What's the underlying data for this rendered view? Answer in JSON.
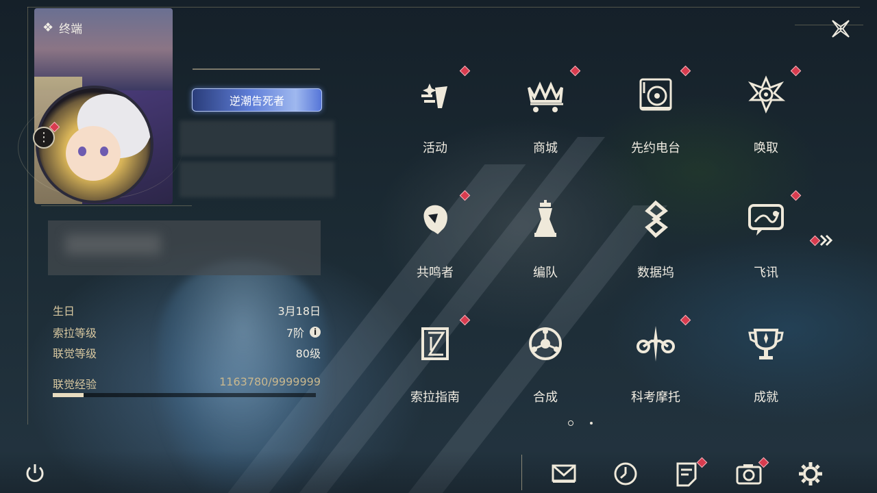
{
  "header": {
    "terminal_label": "终端"
  },
  "profile": {
    "title_badge": "逆潮告死者",
    "stats": [
      {
        "label": "生日",
        "value": "3月18日"
      },
      {
        "label": "索拉等级",
        "value": "7阶"
      },
      {
        "label": "联觉等级",
        "value": "80级"
      }
    ],
    "exp": {
      "label": "联觉经验",
      "value": "1163780/9999999",
      "progress_fraction": 0.116
    }
  },
  "menu": {
    "items": [
      {
        "label": "活动",
        "icon": "event-icon",
        "badge": true
      },
      {
        "label": "商城",
        "icon": "shop-crown-cart-icon",
        "badge": true
      },
      {
        "label": "先约电台",
        "icon": "radio-turntable-icon",
        "badge": true
      },
      {
        "label": "唤取",
        "icon": "summon-compass-icon",
        "badge": true
      },
      {
        "label": "共鸣者",
        "icon": "resonator-head-icon",
        "badge": true
      },
      {
        "label": "编队",
        "icon": "team-chess-icon",
        "badge": false
      },
      {
        "label": "数据坞",
        "icon": "databank-icon",
        "badge": false
      },
      {
        "label": "飞讯",
        "icon": "message-icon",
        "badge": true
      },
      {
        "label": "索拉指南",
        "icon": "guide-book-icon",
        "badge": true
      },
      {
        "label": "合成",
        "icon": "synthesis-icon",
        "badge": false
      },
      {
        "label": "科考摩托",
        "icon": "motorcycle-icon",
        "badge": true
      },
      {
        "label": "成就",
        "icon": "achievement-trophy-icon",
        "badge": false
      }
    ],
    "pages": 2,
    "current_page": 1
  },
  "bottom_bar": {
    "icons": [
      "mail-icon",
      "clock-icon",
      "notice-icon",
      "camera-icon",
      "settings-gear-icon"
    ],
    "badges": [
      false,
      false,
      true,
      true,
      false
    ]
  },
  "colors": {
    "badge_red": "#d83c4f",
    "accent_gold": "#d8c8a0"
  }
}
